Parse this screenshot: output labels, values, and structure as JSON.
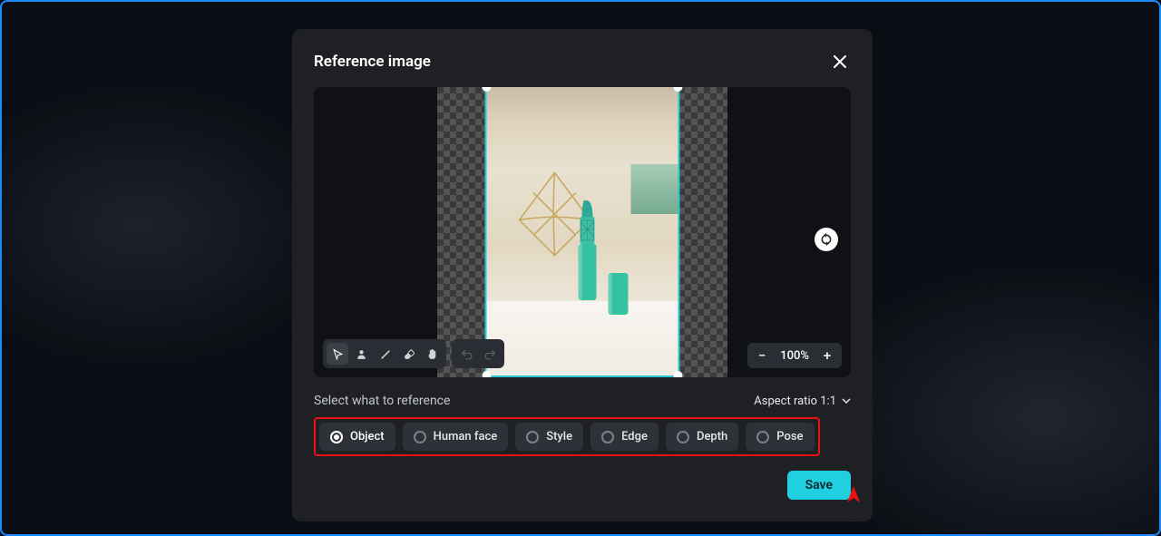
{
  "modal": {
    "title": "Reference image",
    "close_label": "Close",
    "zoom": "100%",
    "subhead": "Select what to reference",
    "aspect": "Aspect ratio 1:1",
    "save": "Save"
  },
  "tools": {
    "pointer": "pointer",
    "crop": "crop",
    "brush": "brush",
    "erase": "erase",
    "hand": "hand",
    "undo": "undo",
    "redo": "redo"
  },
  "options": [
    {
      "label": "Object",
      "selected": true
    },
    {
      "label": "Human face",
      "selected": false
    },
    {
      "label": "Style",
      "selected": false
    },
    {
      "label": "Edge",
      "selected": false
    },
    {
      "label": "Depth",
      "selected": false
    },
    {
      "label": "Pose",
      "selected": false
    }
  ]
}
